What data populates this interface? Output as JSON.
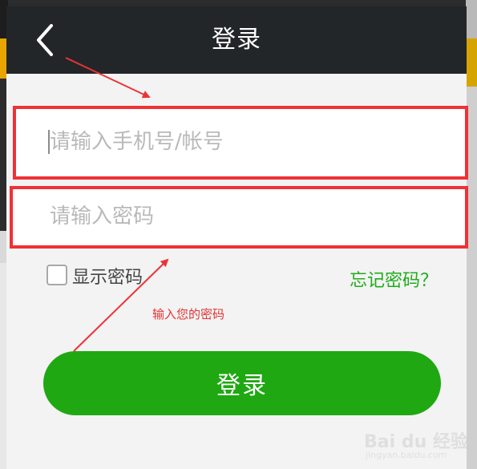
{
  "header": {
    "title": "登录",
    "back_icon": "chevron-left-icon"
  },
  "form": {
    "account_placeholder": "请输入手机号/帐号",
    "account_value": "",
    "password_placeholder": "请输入密码",
    "password_value": "",
    "show_password_label": "显示密码",
    "show_password_checked": false,
    "forgot_password_label": "忘记密码？",
    "login_button_label": "登录"
  },
  "annotation": {
    "text": "输入您的密码"
  },
  "watermark": {
    "brand": "Bai du 经验",
    "url": "jingyan.baidu.com"
  },
  "colors": {
    "header_bg": "#232629",
    "accent_green": "#1fa812",
    "forgot_link": "#1fad1a",
    "annotation_red": "#ee3236",
    "dialog_bg": "#f3f3f3"
  }
}
